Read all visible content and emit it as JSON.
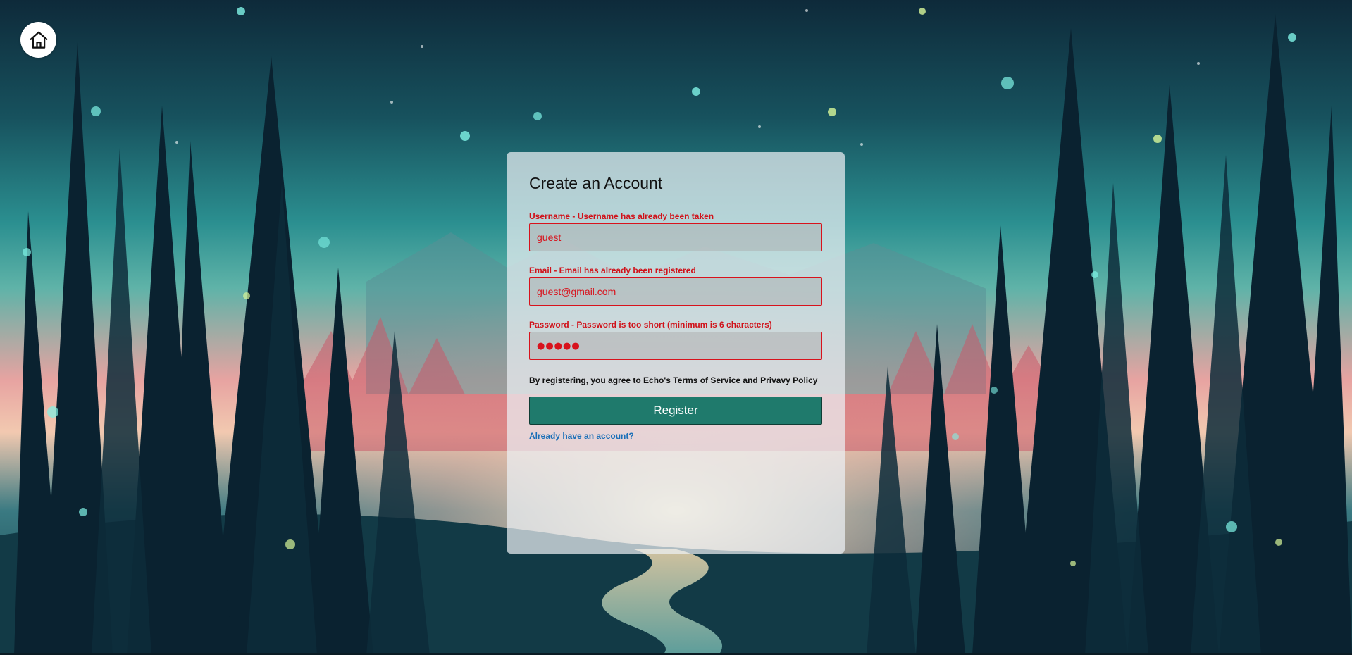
{
  "colors": {
    "error": "#d8121c",
    "primary_button": "#1f7a6c",
    "link": "#1a6fb8"
  },
  "nav": {
    "home_icon": "home-icon"
  },
  "form": {
    "title": "Create an Account",
    "username": {
      "label": "Username - Username has already been taken",
      "value": "guest"
    },
    "email": {
      "label": "Email - Email has already been registered",
      "value": "guest@gmail.com"
    },
    "password": {
      "label": "Password - Password is too short (minimum is 6 characters)",
      "value": "●●●●●"
    },
    "terms_prefix": "By registering, you agree to Echo's ",
    "terms_of_service": "Terms of Service",
    "terms_and": " and ",
    "privacy_policy": "Privavy Policy",
    "register_label": "Register",
    "login_link": "Already have an account?"
  }
}
